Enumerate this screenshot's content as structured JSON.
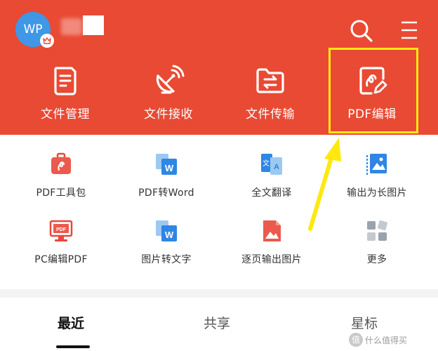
{
  "header": {
    "avatar_text": "WP",
    "search_icon": "search-icon",
    "menu_icon": "menu-icon",
    "bg_color": "#e84a34"
  },
  "quick_tools": [
    {
      "label": "文件管理",
      "icon": "document-list-icon"
    },
    {
      "label": "文件接收",
      "icon": "satellite-dish-icon"
    },
    {
      "label": "文件传输",
      "icon": "folder-transfer-icon"
    },
    {
      "label": "PDF编辑",
      "icon": "pdf-edit-icon"
    }
  ],
  "grid": [
    {
      "label": "PDF工具包",
      "icon": "pdf-toolkit-icon"
    },
    {
      "label": "PDF转Word",
      "icon": "pdf-to-word-icon"
    },
    {
      "label": "全文翻译",
      "icon": "translate-icon"
    },
    {
      "label": "输出为长图片",
      "icon": "long-image-icon"
    },
    {
      "label": "PC编辑PDF",
      "icon": "pc-pdf-icon"
    },
    {
      "label": "图片转文字",
      "icon": "image-to-text-icon"
    },
    {
      "label": "逐页输出图片",
      "icon": "page-image-icon"
    },
    {
      "label": "更多",
      "icon": "more-apps-icon"
    }
  ],
  "tabs": [
    {
      "label": "最近",
      "active": true
    },
    {
      "label": "共享",
      "active": false
    },
    {
      "label": "星标",
      "active": false
    }
  ],
  "watermark": {
    "text": "值 什么值得买",
    "icon_text": "值"
  },
  "colors": {
    "accent_red": "#e84a34",
    "highlight_yellow": "#ffe810",
    "avatar_blue": "#3f97e6"
  }
}
